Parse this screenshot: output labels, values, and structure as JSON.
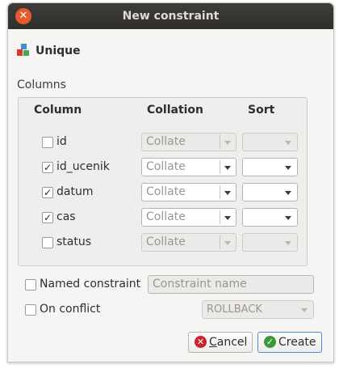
{
  "window": {
    "title": "New constraint"
  },
  "constraint": {
    "type_label": "Unique"
  },
  "columns_section": {
    "label": "Columns",
    "headers": {
      "column": "Column",
      "collation": "Collation",
      "sort": "Sort"
    },
    "rows": [
      {
        "name": "id",
        "checked": false,
        "collation": "Collate",
        "collation_enabled": false,
        "sort": "",
        "sort_enabled": false
      },
      {
        "name": "id_ucenik",
        "checked": true,
        "collation": "Collate",
        "collation_enabled": true,
        "sort": "",
        "sort_enabled": true
      },
      {
        "name": "datum",
        "checked": true,
        "collation": "Collate",
        "collation_enabled": true,
        "sort": "",
        "sort_enabled": true
      },
      {
        "name": "cas",
        "checked": true,
        "collation": "Collate",
        "collation_enabled": true,
        "sort": "",
        "sort_enabled": true
      },
      {
        "name": "status",
        "checked": false,
        "collation": "Collate",
        "collation_enabled": false,
        "sort": "",
        "sort_enabled": false
      }
    ]
  },
  "named_constraint": {
    "label": "Named constraint",
    "checked": false,
    "placeholder": "Constraint name"
  },
  "on_conflict": {
    "label": "On conflict",
    "checked": false,
    "value": "ROLLBACK"
  },
  "buttons": {
    "cancel_mnemonic": "C",
    "cancel_rest": "ancel",
    "create": "Create"
  },
  "colors": {
    "titlebar": "#302f2c",
    "close": "#e65a2c",
    "cancel_icon": "#c7252b",
    "create_icon": "#3a9a3a",
    "focus_border": "#4a8fd1"
  },
  "icons": {
    "close": "close-icon",
    "constraint_type": "unique-constraint-icon",
    "cancel": "cancel-icon",
    "create": "create-icon"
  }
}
